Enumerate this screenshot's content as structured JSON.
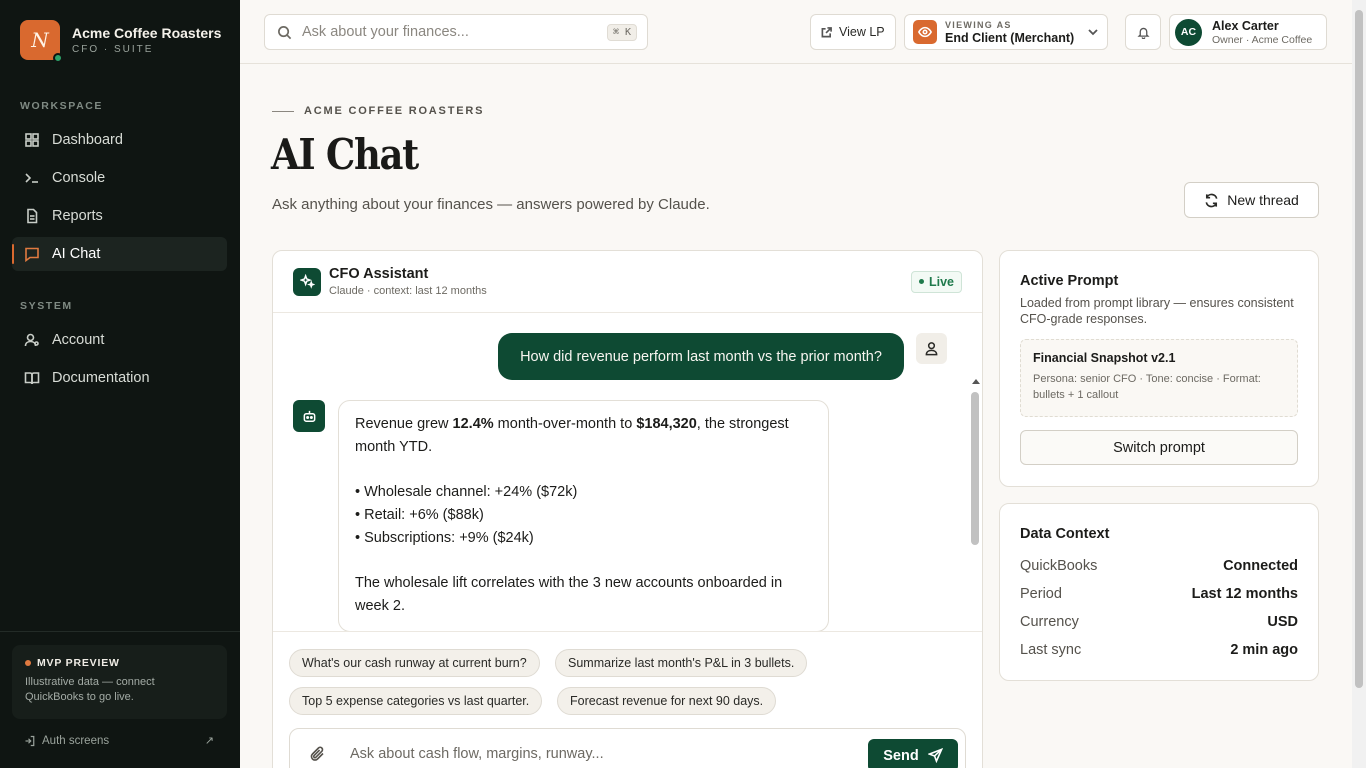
{
  "sidebar": {
    "brand_name": "Acme Coffee Roasters",
    "brand_sub": "CFO · SUITE",
    "logo_letter": "N",
    "workspace_label": "WORKSPACE",
    "system_label": "SYSTEM",
    "items": [
      {
        "label": "Dashboard",
        "icon": "grid-icon"
      },
      {
        "label": "Console",
        "icon": "terminal-icon"
      },
      {
        "label": "Reports",
        "icon": "document-icon"
      },
      {
        "label": "AI Chat",
        "icon": "chat-icon",
        "active": true
      },
      {
        "label": "Account",
        "icon": "user-icon"
      },
      {
        "label": "Documentation",
        "icon": "book-icon"
      }
    ],
    "mvp_title": "MVP PREVIEW",
    "mvp_text": "Illustrative data — connect QuickBooks to go live.",
    "auth_label": "Auth screens",
    "auth_arrow": "↗"
  },
  "topbar": {
    "search_placeholder": "Ask about your finances...",
    "shortcut": "⌘ K",
    "view_lp": "View LP",
    "viewing_label": "VIEWING AS",
    "viewing_value": "End Client (Merchant)",
    "user_initials": "AC",
    "user_name": "Alex Carter",
    "user_role": "Owner · Acme Coffee"
  },
  "page": {
    "eyebrow": "ACME COFFEE ROASTERS",
    "title": "AI Chat",
    "subtitle": "Ask anything about your finances — answers powered by Claude.",
    "new_thread": "New thread"
  },
  "chat": {
    "assistant_name": "CFO Assistant",
    "assistant_meta": "Claude · context: last 12 months",
    "status": "Live",
    "user_message": "How did revenue perform last month vs the prior month?",
    "bot": {
      "intro_a": "Revenue grew ",
      "growth": "12.4%",
      "intro_b": " month-over-month to ",
      "amount": "$184,320",
      "intro_c": ", the strongest month YTD.",
      "bullets": [
        "• Wholesale channel: +24% ($72k)",
        "• Retail: +6% ($88k)",
        "• Subscriptions: +9% ($24k)"
      ],
      "closing": "The wholesale lift correlates with the 3 new accounts onboarded in week 2."
    },
    "suggestions": [
      "What's our cash runway at current burn?",
      "Summarize last month's P&L in 3 bullets.",
      "Top 5 expense categories vs last quarter.",
      "Forecast revenue for next 90 days."
    ],
    "composer_placeholder": "Ask about cash flow, margins, runway...",
    "send_label": "Send"
  },
  "active_prompt": {
    "title": "Active Prompt",
    "desc": "Loaded from prompt library — ensures consistent CFO-grade responses.",
    "prompt_name": "Financial Snapshot v2.1",
    "prompt_meta": "Persona: senior CFO · Tone: concise · Format: bullets + 1 callout",
    "switch_label": "Switch prompt"
  },
  "data_context": {
    "title": "Data Context",
    "rows": [
      {
        "key": "QuickBooks",
        "value": "Connected"
      },
      {
        "key": "Period",
        "value": "Last 12 months"
      },
      {
        "key": "Currency",
        "value": "USD"
      },
      {
        "key": "Last sync",
        "value": "2 min ago"
      }
    ]
  },
  "colors": {
    "sidebar_bg": "#0f1512",
    "brand_accent": "#d9692f",
    "primary_green": "#0e4a33",
    "page_bg": "#faf8f5"
  }
}
